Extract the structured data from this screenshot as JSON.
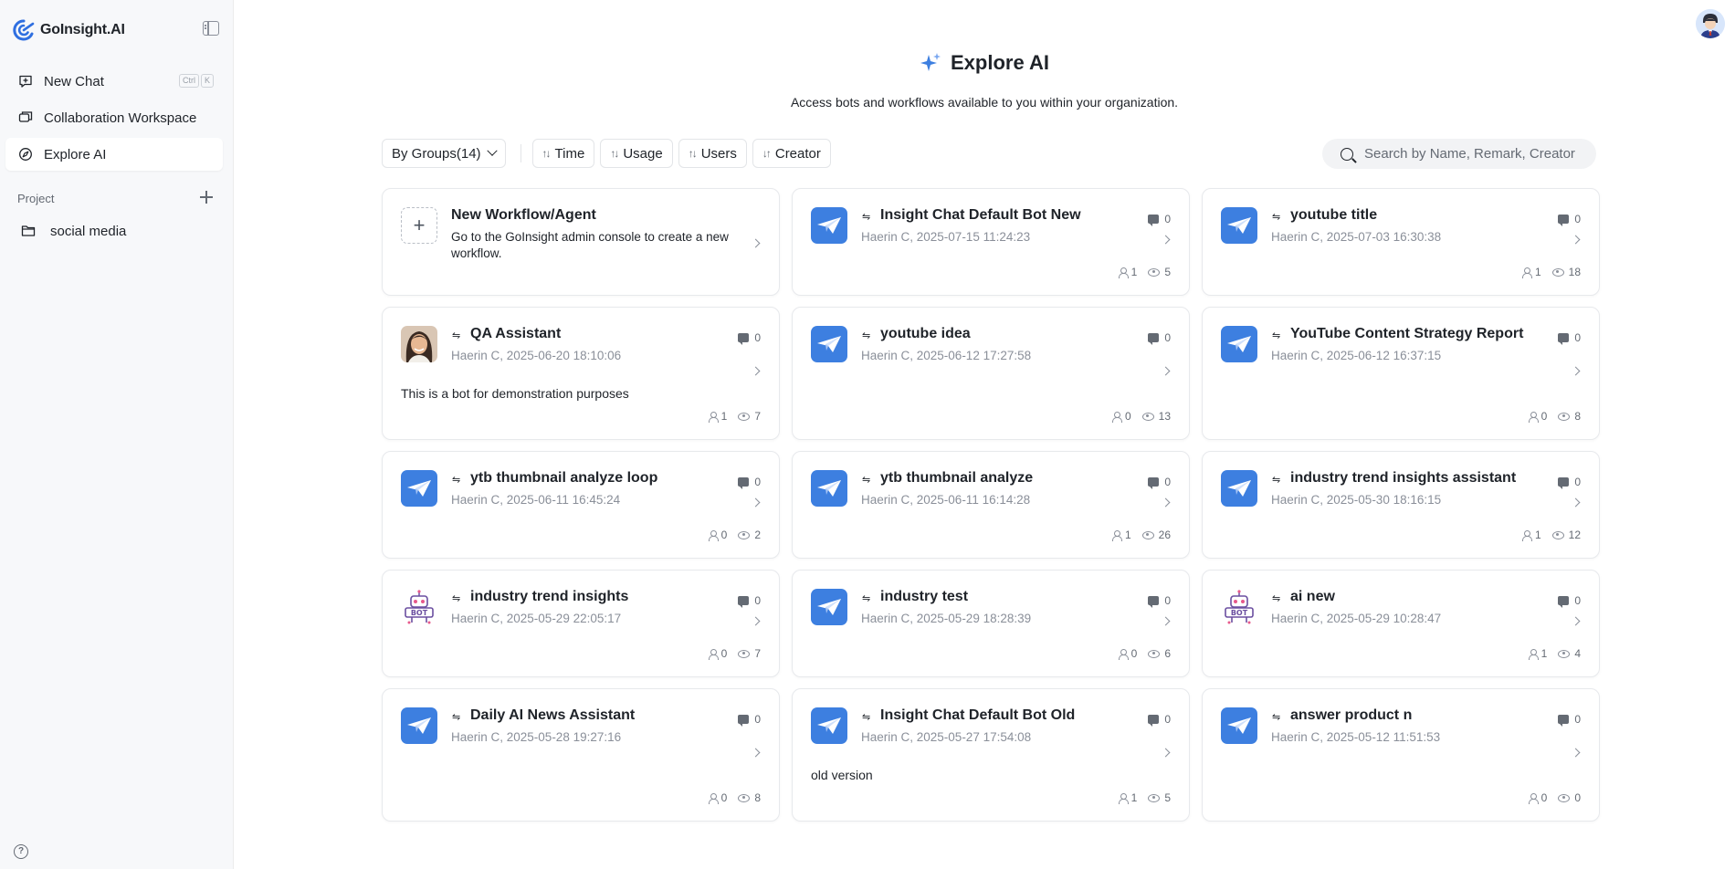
{
  "brand": {
    "name": "GoInsight.AI"
  },
  "sidebar": {
    "items": [
      {
        "label": "New Chat",
        "shortcut": [
          "Ctrl",
          "K"
        ]
      },
      {
        "label": "Collaboration Workspace"
      },
      {
        "label": "Explore AI"
      }
    ],
    "project_label": "Project",
    "projects": [
      {
        "label": "social media"
      }
    ]
  },
  "hero": {
    "title": "Explore AI",
    "subtitle": "Access bots and workflows available to you within your organization."
  },
  "toolbar": {
    "group_select": "By Groups(14)",
    "sort_time": "Time",
    "sort_usage": "Usage",
    "sort_users": "Users",
    "sort_creator": "Creator"
  },
  "search": {
    "placeholder": "Search by Name, Remark, Creator"
  },
  "new_card": {
    "title": "New Workflow/Agent",
    "desc": "Go to the GoInsight admin console to create a new workflow."
  },
  "cards": [
    {
      "title": "Insight Chat Default Bot New",
      "meta": "Haerin C, 2025-07-15 11:24:23",
      "messages": "0",
      "users": "1",
      "views": "5",
      "desc": "",
      "icon": "paper-plane"
    },
    {
      "title": "youtube title",
      "meta": "Haerin C, 2025-07-03 16:30:38",
      "messages": "0",
      "users": "1",
      "views": "18",
      "desc": "",
      "icon": "paper-plane"
    },
    {
      "title": "QA Assistant",
      "meta": "Haerin C, 2025-06-20 18:10:06",
      "messages": "0",
      "users": "1",
      "views": "7",
      "desc": "This is a bot for demonstration purposes",
      "icon": "woman-avatar"
    },
    {
      "title": "youtube idea",
      "meta": "Haerin C, 2025-06-12 17:27:58",
      "messages": "0",
      "users": "0",
      "views": "13",
      "desc": "",
      "icon": "paper-plane"
    },
    {
      "title": "YouTube Content Strategy Report",
      "meta": "Haerin C, 2025-06-12 16:37:15",
      "messages": "0",
      "users": "0",
      "views": "8",
      "desc": "",
      "icon": "paper-plane"
    },
    {
      "title": "ytb thumbnail analyze loop",
      "meta": "Haerin C, 2025-06-11 16:45:24",
      "messages": "0",
      "users": "0",
      "views": "2",
      "desc": "",
      "icon": "paper-plane"
    },
    {
      "title": "ytb thumbnail analyze",
      "meta": "Haerin C, 2025-06-11 16:14:28",
      "messages": "0",
      "users": "1",
      "views": "26",
      "desc": "",
      "icon": "paper-plane"
    },
    {
      "title": "industry trend insights assistant",
      "meta": "Haerin C, 2025-05-30 18:16:15",
      "messages": "0",
      "users": "1",
      "views": "12",
      "desc": "",
      "icon": "paper-plane"
    },
    {
      "title": "industry trend insights",
      "meta": "Haerin C, 2025-05-29 22:05:17",
      "messages": "0",
      "users": "0",
      "views": "7",
      "desc": "",
      "icon": "robot"
    },
    {
      "title": "industry test",
      "meta": "Haerin C, 2025-05-29 18:28:39",
      "messages": "0",
      "users": "0",
      "views": "6",
      "desc": "",
      "icon": "paper-plane"
    },
    {
      "title": "ai new",
      "meta": "Haerin C, 2025-05-29 10:28:47",
      "messages": "0",
      "users": "1",
      "views": "4",
      "desc": "",
      "icon": "robot"
    },
    {
      "title": "Daily AI News Assistant",
      "meta": "Haerin C, 2025-05-28 19:27:16",
      "messages": "0",
      "users": "0",
      "views": "8",
      "desc": "",
      "icon": "paper-plane"
    },
    {
      "title": "Insight Chat Default Bot Old",
      "meta": "Haerin C, 2025-05-27 17:54:08",
      "messages": "0",
      "users": "1",
      "views": "5",
      "desc": "old version",
      "icon": "paper-plane"
    },
    {
      "title": "answer product n",
      "meta": "Haerin C, 2025-05-12 11:51:53",
      "messages": "0",
      "users": "0",
      "views": "0",
      "desc": "",
      "icon": "paper-plane"
    }
  ],
  "colors": {
    "accent": "#3d7fe0",
    "sidebar_bg": "#f7f8fa"
  }
}
